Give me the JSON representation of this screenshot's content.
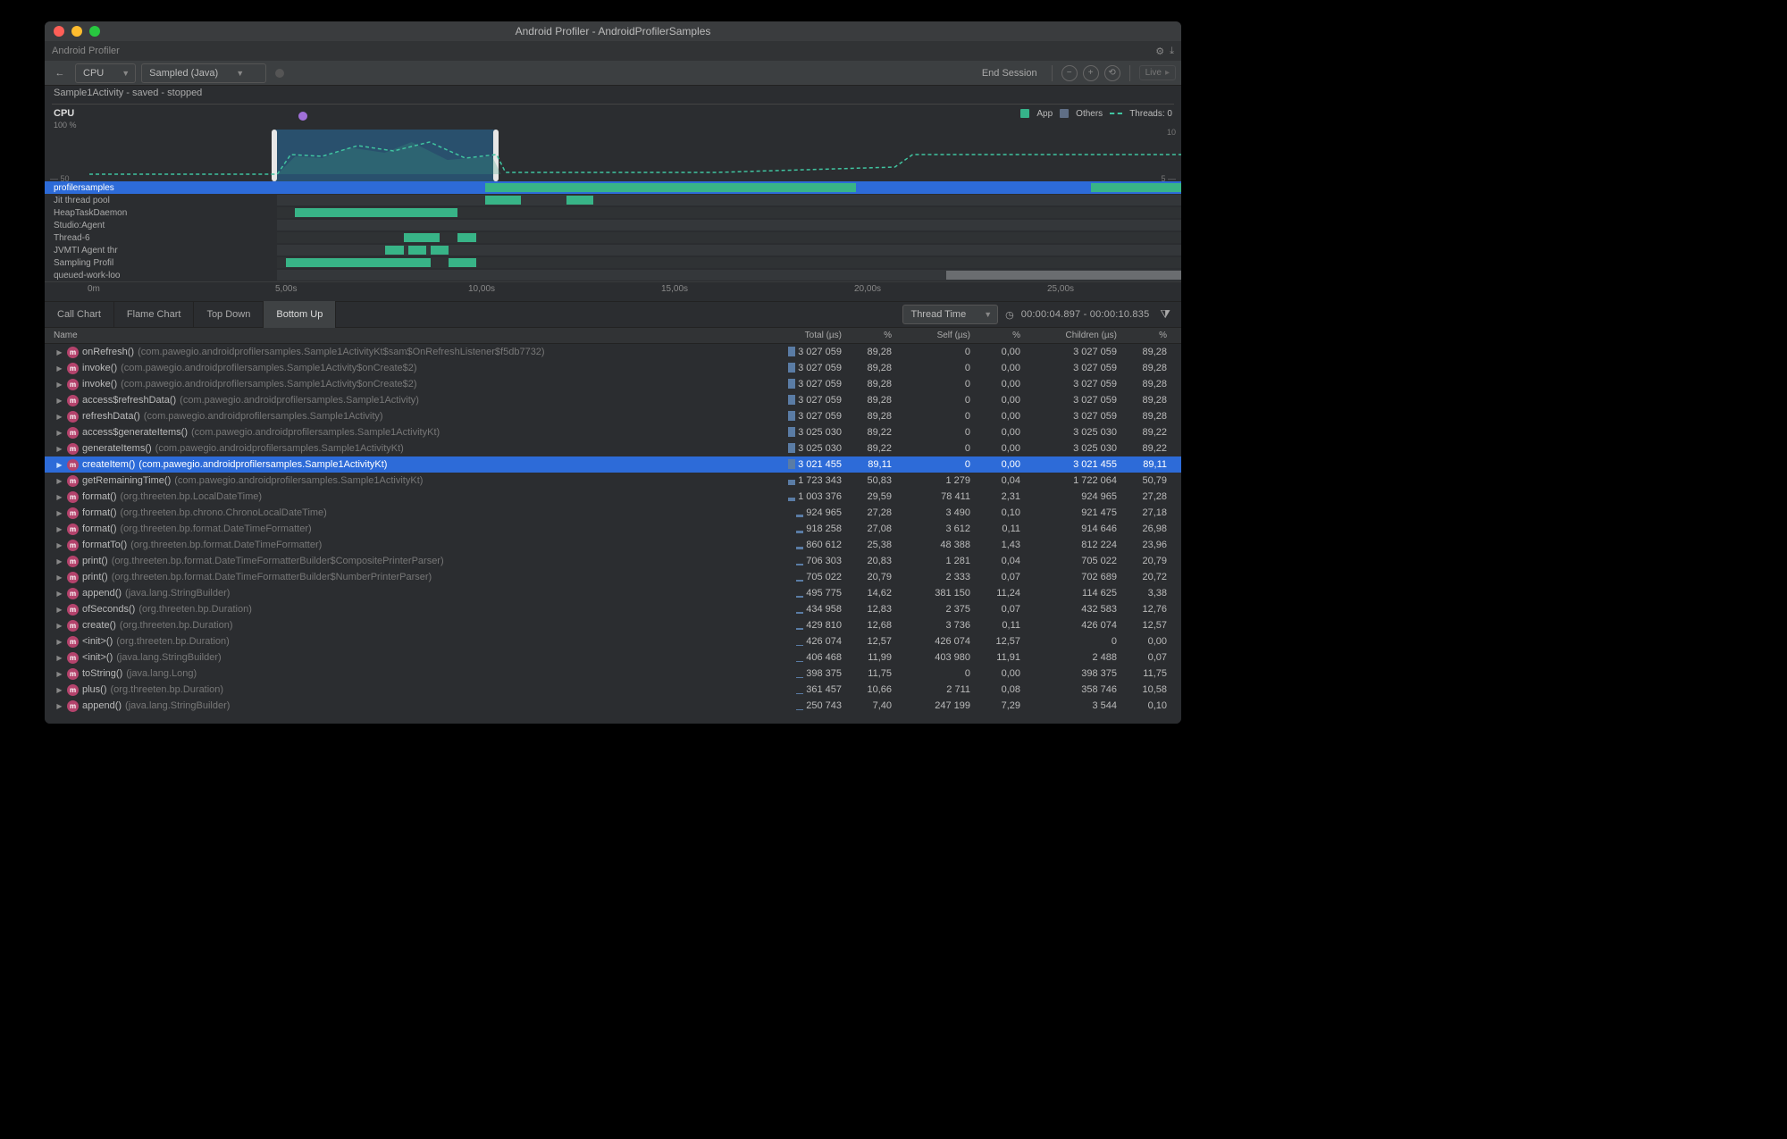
{
  "window_title": "Android Profiler - AndroidProfilerSamples",
  "breadcrumb": "Android Profiler",
  "profiler_dropdown": "CPU",
  "sampling_dropdown": "Sampled (Java)",
  "end_session": "End Session",
  "live_label": "Live",
  "session_label": "Sample1Activity - saved - stopped",
  "cpu_label": "CPU",
  "cpu_percent": "100 %",
  "legend": {
    "app": "App",
    "others": "Others",
    "threads": "Threads: 0"
  },
  "axes": {
    "left_top": "",
    "right_top": "10",
    "left_bottom": "— 50",
    "right_bottom": "5 —"
  },
  "threads": [
    "profilersamples",
    "Jit thread pool",
    "HeapTaskDaemon",
    "Studio:Agent",
    "Thread-6",
    "JVMTI Agent thr",
    "Sampling Profil",
    "queued-work-loo"
  ],
  "time_ticks": [
    {
      "pos": 48,
      "label": "0m"
    },
    {
      "pos": 258,
      "label": "5,00s"
    },
    {
      "pos": 474,
      "label": "10,00s"
    },
    {
      "pos": 690,
      "label": "15,00s"
    },
    {
      "pos": 906,
      "label": "20,00s"
    },
    {
      "pos": 1122,
      "label": "25,00s"
    }
  ],
  "tabs": [
    "Call Chart",
    "Flame Chart",
    "Top Down",
    "Bottom Up"
  ],
  "active_tab": 3,
  "thread_time_dropdown": "Thread Time",
  "time_range": "00:00:04.897 - 00:00:10.835",
  "columns": [
    "Name",
    "Total (µs)",
    "%",
    "Self (µs)",
    "%",
    "Children (µs)",
    "%"
  ],
  "rows": [
    {
      "m": "onRefresh()",
      "p": "(com.pawegio.androidprofilersamples.Sample1ActivityKt$sam$OnRefreshListener$f5db7732)",
      "t": "3 027 059",
      "tp": "89,28",
      "s": "0",
      "sp": "0,00",
      "c": "3 027 059",
      "cp": "89,28",
      "sel": false
    },
    {
      "m": "invoke()",
      "p": "(com.pawegio.androidprofilersamples.Sample1Activity$onCreate$2)",
      "t": "3 027 059",
      "tp": "89,28",
      "s": "0",
      "sp": "0,00",
      "c": "3 027 059",
      "cp": "89,28"
    },
    {
      "m": "invoke()",
      "p": "(com.pawegio.androidprofilersamples.Sample1Activity$onCreate$2)",
      "t": "3 027 059",
      "tp": "89,28",
      "s": "0",
      "sp": "0,00",
      "c": "3 027 059",
      "cp": "89,28"
    },
    {
      "m": "access$refreshData()",
      "p": "(com.pawegio.androidprofilersamples.Sample1Activity)",
      "t": "3 027 059",
      "tp": "89,28",
      "s": "0",
      "sp": "0,00",
      "c": "3 027 059",
      "cp": "89,28"
    },
    {
      "m": "refreshData()",
      "p": "(com.pawegio.androidprofilersamples.Sample1Activity)",
      "t": "3 027 059",
      "tp": "89,28",
      "s": "0",
      "sp": "0,00",
      "c": "3 027 059",
      "cp": "89,28"
    },
    {
      "m": "access$generateItems()",
      "p": "(com.pawegio.androidprofilersamples.Sample1ActivityKt)",
      "t": "3 025 030",
      "tp": "89,22",
      "s": "0",
      "sp": "0,00",
      "c": "3 025 030",
      "cp": "89,22"
    },
    {
      "m": "generateItems()",
      "p": "(com.pawegio.androidprofilersamples.Sample1ActivityKt)",
      "t": "3 025 030",
      "tp": "89,22",
      "s": "0",
      "sp": "0,00",
      "c": "3 025 030",
      "cp": "89,22"
    },
    {
      "m": "createItem()",
      "p": "(com.pawegio.androidprofilersamples.Sample1ActivityKt)",
      "t": "3 021 455",
      "tp": "89,11",
      "s": "0",
      "sp": "0,00",
      "c": "3 021 455",
      "cp": "89,11",
      "sel": true
    },
    {
      "m": "getRemainingTime()",
      "p": "(com.pawegio.androidprofilersamples.Sample1ActivityKt)",
      "t": "1 723 343",
      "tp": "50,83",
      "s": "1 279",
      "sp": "0,04",
      "c": "1 722 064",
      "cp": "50,79"
    },
    {
      "m": "format()",
      "p": "(org.threeten.bp.LocalDateTime)",
      "t": "1 003 376",
      "tp": "29,59",
      "s": "78 411",
      "sp": "2,31",
      "c": "924 965",
      "cp": "27,28"
    },
    {
      "m": "format()",
      "p": "(org.threeten.bp.chrono.ChronoLocalDateTime)",
      "t": "924 965",
      "tp": "27,28",
      "s": "3 490",
      "sp": "0,10",
      "c": "921 475",
      "cp": "27,18"
    },
    {
      "m": "format()",
      "p": "(org.threeten.bp.format.DateTimeFormatter)",
      "t": "918 258",
      "tp": "27,08",
      "s": "3 612",
      "sp": "0,11",
      "c": "914 646",
      "cp": "26,98"
    },
    {
      "m": "formatTo()",
      "p": "(org.threeten.bp.format.DateTimeFormatter)",
      "t": "860 612",
      "tp": "25,38",
      "s": "48 388",
      "sp": "1,43",
      "c": "812 224",
      "cp": "23,96"
    },
    {
      "m": "print()",
      "p": "(org.threeten.bp.format.DateTimeFormatterBuilder$CompositePrinterParser)",
      "t": "706 303",
      "tp": "20,83",
      "s": "1 281",
      "sp": "0,04",
      "c": "705 022",
      "cp": "20,79"
    },
    {
      "m": "print()",
      "p": "(org.threeten.bp.format.DateTimeFormatterBuilder$NumberPrinterParser)",
      "t": "705 022",
      "tp": "20,79",
      "s": "2 333",
      "sp": "0,07",
      "c": "702 689",
      "cp": "20,72"
    },
    {
      "m": "append()",
      "p": "(java.lang.StringBuilder)",
      "t": "495 775",
      "tp": "14,62",
      "s": "381 150",
      "sp": "11,24",
      "c": "114 625",
      "cp": "3,38"
    },
    {
      "m": "ofSeconds()",
      "p": "(org.threeten.bp.Duration)",
      "t": "434 958",
      "tp": "12,83",
      "s": "2 375",
      "sp": "0,07",
      "c": "432 583",
      "cp": "12,76"
    },
    {
      "m": "create()",
      "p": "(org.threeten.bp.Duration)",
      "t": "429 810",
      "tp": "12,68",
      "s": "3 736",
      "sp": "0,11",
      "c": "426 074",
      "cp": "12,57"
    },
    {
      "m": "<init>()",
      "p": "(org.threeten.bp.Duration)",
      "t": "426 074",
      "tp": "12,57",
      "s": "426 074",
      "sp": "12,57",
      "c": "0",
      "cp": "0,00"
    },
    {
      "m": "<init>()",
      "p": "(java.lang.StringBuilder)",
      "t": "406 468",
      "tp": "11,99",
      "s": "403 980",
      "sp": "11,91",
      "c": "2 488",
      "cp": "0,07"
    },
    {
      "m": "toString()",
      "p": "(java.lang.Long)",
      "t": "398 375",
      "tp": "11,75",
      "s": "0",
      "sp": "0,00",
      "c": "398 375",
      "cp": "11,75"
    },
    {
      "m": "plus()",
      "p": "(org.threeten.bp.Duration)",
      "t": "361 457",
      "tp": "10,66",
      "s": "2 711",
      "sp": "0,08",
      "c": "358 746",
      "cp": "10,58"
    },
    {
      "m": "append()",
      "p": "(java.lang.StringBuilder)",
      "t": "250 743",
      "tp": "7,40",
      "s": "247 199",
      "sp": "7,29",
      "c": "3 544",
      "cp": "0,10"
    }
  ],
  "segments": {
    "0": [
      {
        "l": 23,
        "w": 41,
        "c": "g"
      },
      {
        "l": 90,
        "w": 12,
        "c": "g"
      }
    ],
    "1": [
      {
        "l": 23,
        "w": 4,
        "c": "g"
      },
      {
        "l": 32,
        "w": 3,
        "c": "g"
      }
    ],
    "2": [
      {
        "l": 2,
        "w": 18,
        "c": "g"
      }
    ],
    "3": [],
    "4": [
      {
        "l": 14,
        "w": 4,
        "c": "g"
      },
      {
        "l": 20,
        "w": 2,
        "c": "g"
      }
    ],
    "5": [
      {
        "l": 12,
        "w": 2,
        "c": "g"
      },
      {
        "l": 14.5,
        "w": 2,
        "c": "g"
      },
      {
        "l": 17,
        "w": 2,
        "c": "g"
      }
    ],
    "6": [
      {
        "l": 1,
        "w": 16,
        "c": "g"
      },
      {
        "l": 19,
        "w": 3,
        "c": "g"
      }
    ],
    "7": [
      {
        "l": 74,
        "w": 26,
        "c": "gray"
      }
    ]
  }
}
